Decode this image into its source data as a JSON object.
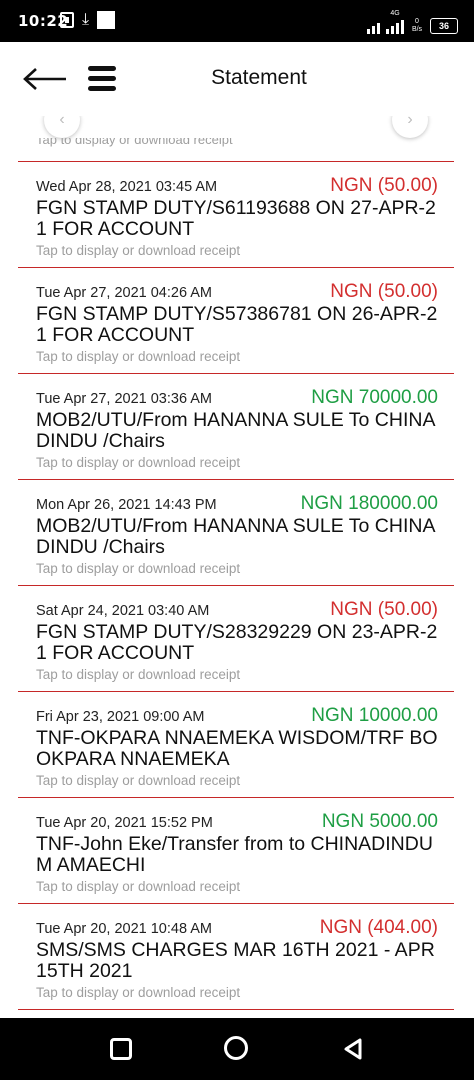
{
  "status_bar": {
    "time": "10:22",
    "network": "4G",
    "speed": "0 B/s",
    "battery": "36"
  },
  "header": {
    "title": "Statement"
  },
  "list": {
    "hint_text": "Tap to display or download receipt",
    "transactions": [
      {
        "date": "Wed Apr 28, 2021 03:45 AM",
        "amount": "NGN (50.00)",
        "type": "debit",
        "description": "FGN STAMP DUTY/S61193688 ON 27-APR-21 FOR ACCOUNT"
      },
      {
        "date": "Tue Apr 27, 2021 04:26 AM",
        "amount": "NGN (50.00)",
        "type": "debit",
        "description": "FGN STAMP DUTY/S57386781 ON 26-APR-21 FOR ACCOUNT"
      },
      {
        "date": "Tue Apr 27, 2021 03:36 AM",
        "amount": "NGN 70000.00",
        "type": "credit",
        "description": "MOB2/UTU/From HANANNA SULE To CHINADINDU /Chairs"
      },
      {
        "date": "Mon Apr 26, 2021 14:43 PM",
        "amount": "NGN 180000.00",
        "type": "credit",
        "description": "MOB2/UTU/From HANANNA SULE To CHINADINDU /Chairs"
      },
      {
        "date": "Sat Apr 24, 2021 03:40 AM",
        "amount": "NGN (50.00)",
        "type": "debit",
        "description": "FGN STAMP DUTY/S28329229 ON 23-APR-21 FOR ACCOUNT"
      },
      {
        "date": "Fri Apr 23, 2021 09:00 AM",
        "amount": "NGN 10000.00",
        "type": "credit",
        "description": "TNF-OKPARA NNAEMEKA WISDOM/TRF BO OKPARA NNAEMEKA"
      },
      {
        "date": "Tue Apr 20, 2021 15:52 PM",
        "amount": "NGN 5000.00",
        "type": "credit",
        "description": "TNF-John Eke/Transfer from to CHINADINDU M AMAECHI"
      },
      {
        "date": "Tue Apr 20, 2021 10:48 AM",
        "amount": "NGN (404.00)",
        "type": "debit",
        "description": "SMS/SMS CHARGES MAR 16TH 2021 - APR 15TH 2021"
      }
    ]
  },
  "colors": {
    "debit": "#d32f2f",
    "credit": "#1e9e44",
    "divider": "#c62828"
  }
}
